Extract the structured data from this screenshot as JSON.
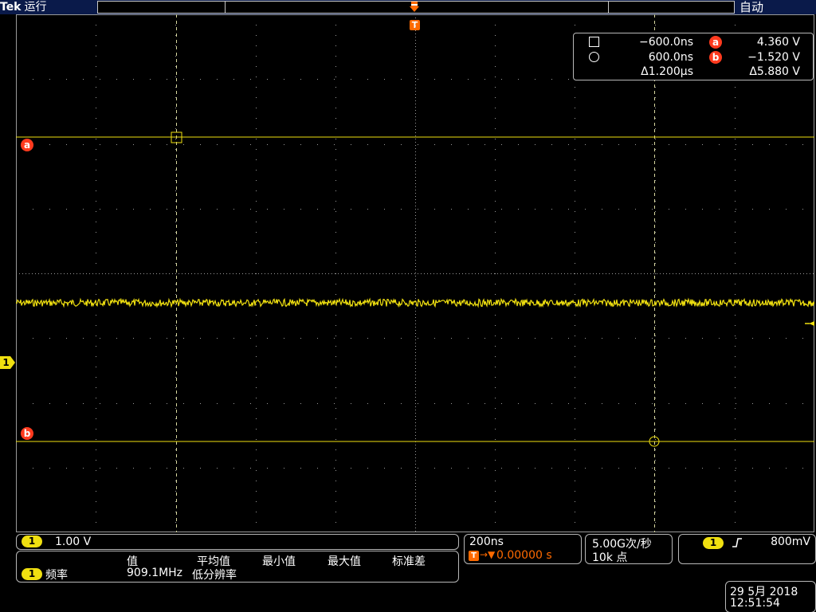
{
  "top_bar": {
    "brand": "Tek",
    "run_status": "运行",
    "trigger_mode": "自动"
  },
  "trigger_marker": "T",
  "cursors": {
    "a_label": "a",
    "b_label": "b"
  },
  "channel_marker": "1",
  "cursor_readout": {
    "cursor1_time": "−600.0ns",
    "cursor_a_voltage": "4.360 V",
    "cursor2_time": "600.0ns",
    "cursor_b_voltage": "−1.520 V",
    "delta_time": "Δ1.200µs",
    "delta_voltage": "Δ5.880 V",
    "cursor_a_badge": "a",
    "cursor_b_badge": "b"
  },
  "vertical": {
    "channel": "1",
    "scale": "1.00 V"
  },
  "measurements": {
    "headers": [
      "值",
      "平均值",
      "最小值",
      "最大值",
      "标准差"
    ],
    "rows": [
      {
        "channel": "1",
        "name": "频率",
        "value": "909.1MHz",
        "note": "低分辨率"
      }
    ]
  },
  "horizontal": {
    "time_per_div": "200ns",
    "trigger_icon": "T",
    "position": "0.00000 s"
  },
  "acquisition": {
    "sample_rate": "5.00G次/秒",
    "record_length": "10k 点"
  },
  "trigger": {
    "channel": "1",
    "slope_icon": "rising-edge-icon",
    "level": "800mV"
  },
  "datetime": {
    "date": "29 5月  2018",
    "time": "12:51:54"
  },
  "colors": {
    "background": "#000000",
    "trace": "#f0e010",
    "cursor": "#f0e010",
    "marker_orange": "#ff6a00",
    "marker_red": "#ff3a1e",
    "grid": "#9a9a9a",
    "top_bar": "#0a1a4a"
  }
}
